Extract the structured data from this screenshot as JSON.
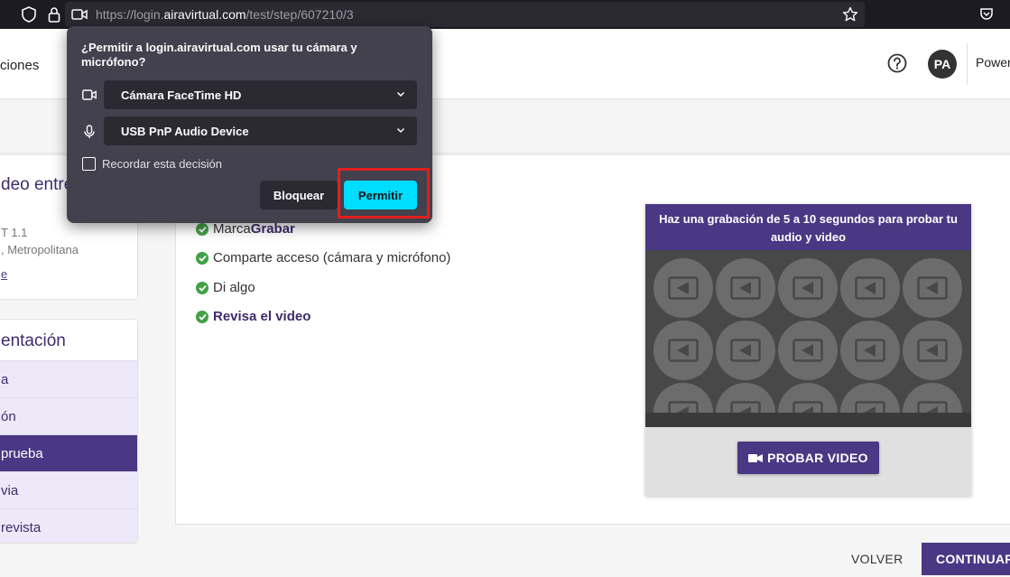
{
  "browser": {
    "url_prefix": "https://login.",
    "url_domain": "airavirtual.com",
    "url_path": "/test/step/607210/3"
  },
  "header": {
    "nav_fragment": "ciones",
    "avatar_initials": "PA",
    "powered_fragment": "Power"
  },
  "sidebar": {
    "card1": {
      "title": "deo entre",
      "line1": "T 1.1",
      "line2": ", Metropolitana",
      "line3": "e"
    },
    "card2": {
      "title": "entación",
      "items": [
        {
          "label": "a"
        },
        {
          "label": "ón"
        },
        {
          "label": "prueba"
        },
        {
          "label": "via"
        },
        {
          "label": "revista"
        }
      ],
      "active_index": 2
    }
  },
  "steps": {
    "step1_prefix": "Marca ",
    "step1_highlight": "Grabar",
    "step2": "Comparte acceso (cámara y micrófono)",
    "step3": "Di algo",
    "step4": "Revisa el video"
  },
  "video_card": {
    "header": "Haz una grabación de 5 a 10 segundos para probar tu audio y video",
    "button_label": "PROBAR VIDEO"
  },
  "footer": {
    "back_label": "VOLVER",
    "continue_label": "CONTINUAR"
  },
  "permission_popup": {
    "title": "¿Permitir a login.airavirtual.com usar tu cámara y micrófono?",
    "camera_option": "Cámara FaceTime HD",
    "mic_option": "USB PnP Audio Device",
    "remember_label": "Recordar esta decisión",
    "block_label": "Bloquear",
    "allow_label": "Permitir"
  },
  "colors": {
    "brand_purple": "#4a3884",
    "allow_cyan": "#00ddff",
    "highlight_red": "#e0201e",
    "check_green": "#43a047"
  }
}
